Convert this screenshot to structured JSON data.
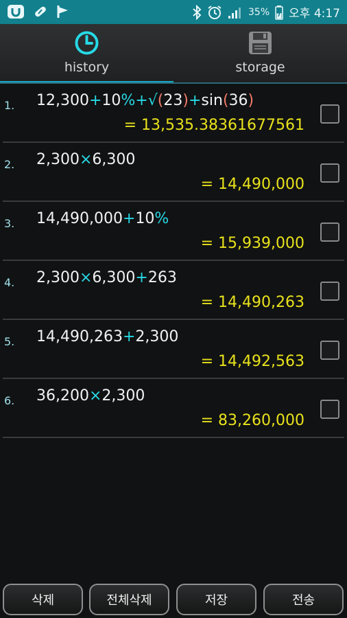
{
  "status_bar": {
    "battery": "35%",
    "time": "오후 4:17",
    "left_icons": [
      "app-u-icon",
      "pill-icon",
      "flag-icon"
    ],
    "right_icons": [
      "bluetooth-icon",
      "alarm-icon",
      "signal-icon",
      "battery-icon"
    ]
  },
  "tabs": [
    {
      "label": "history",
      "icon": "clock-icon",
      "active": true
    },
    {
      "label": "storage",
      "icon": "floppy-disk-icon",
      "active": false
    }
  ],
  "colors": {
    "accent": "#1ea6c2",
    "operator": "#26d9e6",
    "paren": "#f07a6a",
    "result": "#e8e21c"
  },
  "history": [
    {
      "num": "1.",
      "expr": [
        {
          "t": "12,300",
          "c": "n"
        },
        {
          "t": "+",
          "c": "op"
        },
        {
          "t": "10",
          "c": "n"
        },
        {
          "t": "%",
          "c": "op"
        },
        {
          "t": "+",
          "c": "op"
        },
        {
          "t": "√",
          "c": "op"
        },
        {
          "t": "(",
          "c": "p"
        },
        {
          "t": "23",
          "c": "n"
        },
        {
          "t": ")",
          "c": "p"
        },
        {
          "t": "+",
          "c": "op"
        },
        {
          "t": "sin",
          "c": "n"
        },
        {
          "t": "(",
          "c": "p"
        },
        {
          "t": "36",
          "c": "n"
        },
        {
          "t": ")",
          "c": "p"
        }
      ],
      "result": "= 13,535.38361677561",
      "checked": false
    },
    {
      "num": "2.",
      "expr": [
        {
          "t": "2,300",
          "c": "n"
        },
        {
          "t": "×",
          "c": "op"
        },
        {
          "t": "6,300",
          "c": "n"
        }
      ],
      "result": "= 14,490,000",
      "checked": false
    },
    {
      "num": "3.",
      "expr": [
        {
          "t": "14,490,000",
          "c": "n"
        },
        {
          "t": "+",
          "c": "op"
        },
        {
          "t": "10",
          "c": "n"
        },
        {
          "t": "%",
          "c": "op"
        }
      ],
      "result": "= 15,939,000",
      "checked": false
    },
    {
      "num": "4.",
      "expr": [
        {
          "t": "2,300",
          "c": "n"
        },
        {
          "t": "×",
          "c": "op"
        },
        {
          "t": "6,300",
          "c": "n"
        },
        {
          "t": "+",
          "c": "op"
        },
        {
          "t": "263",
          "c": "n"
        }
      ],
      "result": "= 14,490,263",
      "checked": false
    },
    {
      "num": "5.",
      "expr": [
        {
          "t": "14,490,263",
          "c": "n"
        },
        {
          "t": "+",
          "c": "op"
        },
        {
          "t": "2,300",
          "c": "n"
        }
      ],
      "result": "= 14,492,563",
      "checked": false
    },
    {
      "num": "6.",
      "expr": [
        {
          "t": "36,200",
          "c": "n"
        },
        {
          "t": "×",
          "c": "op"
        },
        {
          "t": "2,300",
          "c": "n"
        }
      ],
      "result": "= 83,260,000",
      "checked": false
    }
  ],
  "buttons": {
    "delete": "삭제",
    "delete_all": "전체삭제",
    "save": "저장",
    "send": "전송"
  }
}
